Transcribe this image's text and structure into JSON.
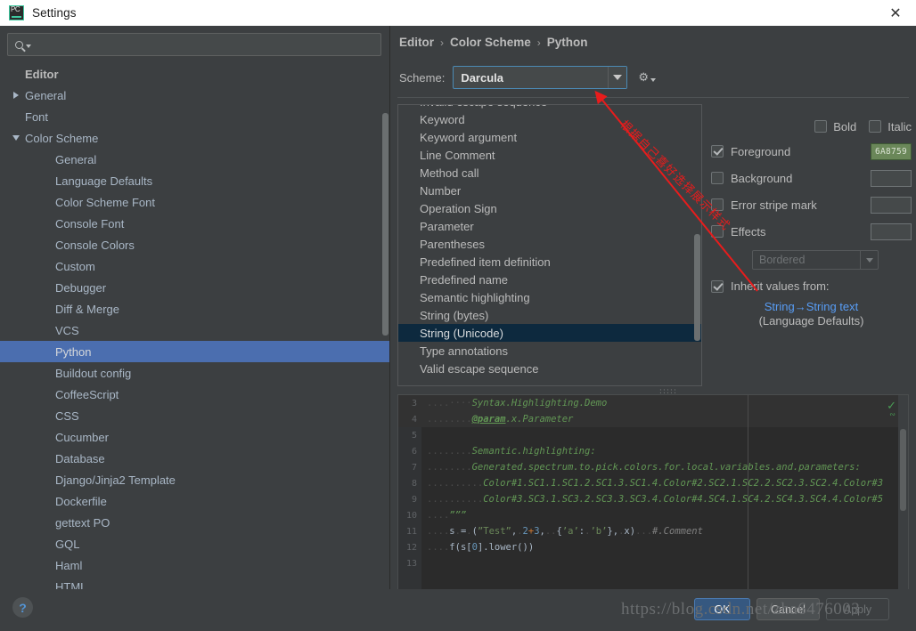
{
  "window": {
    "title": "Settings",
    "app_icon": "pycharm-icon",
    "close_icon": "✕"
  },
  "search": {
    "value": "",
    "placeholder": "",
    "icon": "search-icon"
  },
  "sidebar": {
    "scroll_visible": true,
    "items": [
      {
        "label": "Editor",
        "level": 0,
        "twisty": "none",
        "selected": false
      },
      {
        "label": "General",
        "level": 1,
        "twisty": "collapsed",
        "selected": false
      },
      {
        "label": "Font",
        "level": 1,
        "twisty": "none",
        "selected": false
      },
      {
        "label": "Color Scheme",
        "level": 1,
        "twisty": "expanded",
        "selected": false
      },
      {
        "label": "General",
        "level": 2,
        "twisty": "none",
        "selected": false
      },
      {
        "label": "Language Defaults",
        "level": 2,
        "twisty": "none",
        "selected": false
      },
      {
        "label": "Color Scheme Font",
        "level": 2,
        "twisty": "none",
        "selected": false
      },
      {
        "label": "Console Font",
        "level": 2,
        "twisty": "none",
        "selected": false
      },
      {
        "label": "Console Colors",
        "level": 2,
        "twisty": "none",
        "selected": false
      },
      {
        "label": "Custom",
        "level": 2,
        "twisty": "none",
        "selected": false
      },
      {
        "label": "Debugger",
        "level": 2,
        "twisty": "none",
        "selected": false
      },
      {
        "label": "Diff & Merge",
        "level": 2,
        "twisty": "none",
        "selected": false
      },
      {
        "label": "VCS",
        "level": 2,
        "twisty": "none",
        "selected": false
      },
      {
        "label": "Python",
        "level": 2,
        "twisty": "none",
        "selected": true
      },
      {
        "label": "Buildout config",
        "level": 2,
        "twisty": "none",
        "selected": false
      },
      {
        "label": "CoffeeScript",
        "level": 2,
        "twisty": "none",
        "selected": false
      },
      {
        "label": "CSS",
        "level": 2,
        "twisty": "none",
        "selected": false
      },
      {
        "label": "Cucumber",
        "level": 2,
        "twisty": "none",
        "selected": false
      },
      {
        "label": "Database",
        "level": 2,
        "twisty": "none",
        "selected": false
      },
      {
        "label": "Django/Jinja2 Template",
        "level": 2,
        "twisty": "none",
        "selected": false
      },
      {
        "label": "Dockerfile",
        "level": 2,
        "twisty": "none",
        "selected": false
      },
      {
        "label": "gettext PO",
        "level": 2,
        "twisty": "none",
        "selected": false
      },
      {
        "label": "GQL",
        "level": 2,
        "twisty": "none",
        "selected": false
      },
      {
        "label": "Haml",
        "level": 2,
        "twisty": "none",
        "selected": false
      },
      {
        "label": "HTML",
        "level": 2,
        "twisty": "none",
        "selected": false
      }
    ]
  },
  "breadcrumb": {
    "parts": [
      "Editor",
      "Color Scheme",
      "Python"
    ],
    "separator": "›"
  },
  "scheme": {
    "label": "Scheme:",
    "value": "Darcula",
    "gear_icon": "gear-icon"
  },
  "options_list": {
    "items": [
      {
        "label": "Invalid escape sequence",
        "selected": false
      },
      {
        "label": "Keyword",
        "selected": false
      },
      {
        "label": "Keyword argument",
        "selected": false
      },
      {
        "label": "Line Comment",
        "selected": false
      },
      {
        "label": "Method call",
        "selected": false
      },
      {
        "label": "Number",
        "selected": false
      },
      {
        "label": "Operation Sign",
        "selected": false
      },
      {
        "label": "Parameter",
        "selected": false
      },
      {
        "label": "Parentheses",
        "selected": false
      },
      {
        "label": "Predefined item definition",
        "selected": false
      },
      {
        "label": "Predefined name",
        "selected": false
      },
      {
        "label": "Semantic highlighting",
        "selected": false
      },
      {
        "label": "String (bytes)",
        "selected": false
      },
      {
        "label": "String (Unicode)",
        "selected": true
      },
      {
        "label": "Type annotations",
        "selected": false
      },
      {
        "label": "Valid escape sequence",
        "selected": false
      }
    ]
  },
  "attributes": {
    "bold": {
      "label": "Bold",
      "checked": false
    },
    "italic": {
      "label": "Italic",
      "checked": false
    },
    "foreground": {
      "label": "Foreground",
      "checked": true,
      "color_hex": "6A8759",
      "swatch_color": "#6a8759"
    },
    "background": {
      "label": "Background",
      "checked": false,
      "color_hex": "",
      "swatch_color": ""
    },
    "error_stripe": {
      "label": "Error stripe mark",
      "checked": false,
      "color_hex": "",
      "swatch_color": ""
    },
    "effects": {
      "label": "Effects",
      "checked": false,
      "color_hex": "",
      "swatch_color": ""
    },
    "effect_type": "Bordered"
  },
  "inherit": {
    "label": "Inherit values from:",
    "checked": true,
    "link": "String→String text",
    "sub": "(Language Defaults)"
  },
  "preview": {
    "lines": [
      {
        "num": "3",
        "caret": true,
        "segments": [
          {
            "text": "....",
            "cls": "ws"
          },
          {
            "text": "····",
            "cls": "ws"
          },
          {
            "text": "Syntax.Highlighting.Demo",
            "cls": "doc"
          }
        ]
      },
      {
        "num": "4",
        "caret": true,
        "segments": [
          {
            "text": "........",
            "cls": "ws"
          },
          {
            "text": "@param",
            "cls": "doc-tag"
          },
          {
            "text": ".x.Parameter",
            "cls": "doc"
          }
        ]
      },
      {
        "num": "5",
        "caret": false,
        "segments": []
      },
      {
        "num": "6",
        "caret": false,
        "segments": [
          {
            "text": "........",
            "cls": "ws"
          },
          {
            "text": "Semantic.highlighting:",
            "cls": "doc"
          }
        ]
      },
      {
        "num": "7",
        "caret": false,
        "segments": [
          {
            "text": "........",
            "cls": "ws"
          },
          {
            "text": "Generated.spectrum.to.pick.colors.for.local.variables.and.parameters:",
            "cls": "doc"
          }
        ]
      },
      {
        "num": "8",
        "caret": false,
        "segments": [
          {
            "text": "..........",
            "cls": "ws"
          },
          {
            "text": "Color#1.SC1.1.SC1.2.SC1.3.SC1.4.Color#2.SC2.1.SC2.2.SC2.3.SC2.4.Color#3",
            "cls": "doc"
          }
        ]
      },
      {
        "num": "9",
        "caret": false,
        "segments": [
          {
            "text": "..........",
            "cls": "ws"
          },
          {
            "text": "Color#3.SC3.1.SC3.2.SC3.3.SC3.4.Color#4.SC4.1.SC4.2.SC4.3.SC4.4.Color#5",
            "cls": "doc"
          }
        ]
      },
      {
        "num": "10",
        "caret": false,
        "segments": [
          {
            "text": "....",
            "cls": "ws"
          },
          {
            "text": "”””",
            "cls": "doc"
          }
        ]
      },
      {
        "num": "11",
        "caret": false,
        "segments": [
          {
            "text": "....",
            "cls": "ws"
          },
          {
            "text": "s",
            "cls": "plain"
          },
          {
            "text": ".",
            "cls": "ws"
          },
          {
            "text": "=",
            "cls": "plain"
          },
          {
            "text": ".",
            "cls": "ws"
          },
          {
            "text": "(",
            "cls": "plain"
          },
          {
            "text": "”Test”",
            "cls": "str"
          },
          {
            "text": ",",
            "cls": "plain"
          },
          {
            "text": ".",
            "cls": "ws"
          },
          {
            "text": "2",
            "cls": "num"
          },
          {
            "text": "+",
            "cls": "kw"
          },
          {
            "text": "3",
            "cls": "num"
          },
          {
            "text": ",",
            "cls": "plain"
          },
          {
            "text": "..",
            "cls": "ws"
          },
          {
            "text": "{",
            "cls": "plain"
          },
          {
            "text": "’a’",
            "cls": "str"
          },
          {
            "text": ":",
            "cls": "plain"
          },
          {
            "text": ".",
            "cls": "ws"
          },
          {
            "text": "’b’",
            "cls": "str"
          },
          {
            "text": "}",
            "cls": "plain"
          },
          {
            "text": ",",
            "cls": "plain"
          },
          {
            "text": ".",
            "cls": "ws"
          },
          {
            "text": "x)",
            "cls": "plain"
          },
          {
            "text": "...",
            "cls": "ws"
          },
          {
            "text": "#.Comment",
            "cls": "cmt"
          }
        ]
      },
      {
        "num": "12",
        "caret": false,
        "segments": [
          {
            "text": "....",
            "cls": "ws"
          },
          {
            "text": "f(s[",
            "cls": "plain"
          },
          {
            "text": "0",
            "cls": "num"
          },
          {
            "text": "].lower())",
            "cls": "plain"
          }
        ]
      },
      {
        "num": "13",
        "caret": false,
        "segments": []
      }
    ]
  },
  "buttons": {
    "ok": "OK",
    "cancel": "Cancel",
    "apply": "Apply",
    "help": "?"
  },
  "annotations": {
    "note_text": "根据自己喜好选择展示样式",
    "note_color": "#e81c1c",
    "watermark": "https://blog.csdn.net/zha6476003"
  }
}
